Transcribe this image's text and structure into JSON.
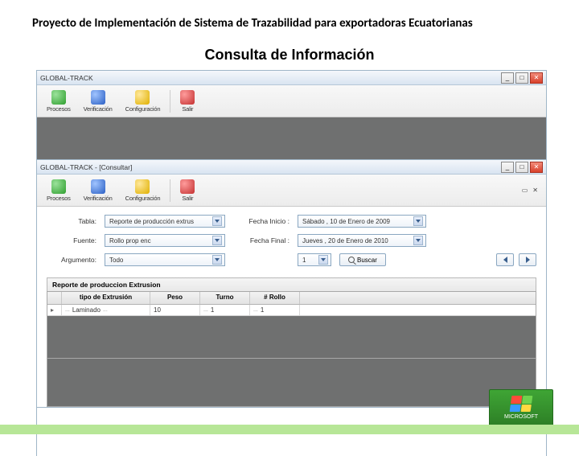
{
  "slide": {
    "title": "Proyecto de Implementación de Sistema de Trazabilidad para exportadoras Ecuatorianas",
    "heading": "Consulta de Información"
  },
  "window1": {
    "title": "GLOBAL-TRACK",
    "toolbar": {
      "procesos": "Procesos",
      "verificacion": "Verificación",
      "configuracion": "Configuración",
      "salir": "Salir"
    }
  },
  "window2": {
    "title": "GLOBAL-TRACK - [Consultar]",
    "child_restore": "▭",
    "child_close": "✕",
    "toolbar": {
      "procesos": "Procesos",
      "verificacion": "Verificación",
      "configuracion": "Configuración",
      "salir": "Salir"
    },
    "form": {
      "tabla_label": "Tabla:",
      "tabla_value": "Reporte de producción extrus",
      "fecha_inicio_label": "Fecha Inicio :",
      "fecha_inicio_value": "Sábado , 10 de  Enero  de 2009",
      "fuente_label": "Fuente:",
      "fuente_value": "Rollo prop enc",
      "fecha_fin_label": "Fecha Final :",
      "fecha_fin_value": "Jueves , 20 de  Enero  de 2010",
      "argumento_label": "Argumento:",
      "argumento_value": "Todo",
      "numero": "1",
      "buscar": "Buscar"
    },
    "grid": {
      "title": "Reporte de produccion Extrusion",
      "headers": {
        "tipo": "tipo de Extrusión",
        "peso": "Peso",
        "turno": "Turno",
        "rollo": "# Rollo"
      },
      "row": {
        "tipo": "Laminado",
        "peso": "10",
        "turno": "1",
        "rollo": "1"
      }
    }
  },
  "box_label": "MICROSOFT"
}
